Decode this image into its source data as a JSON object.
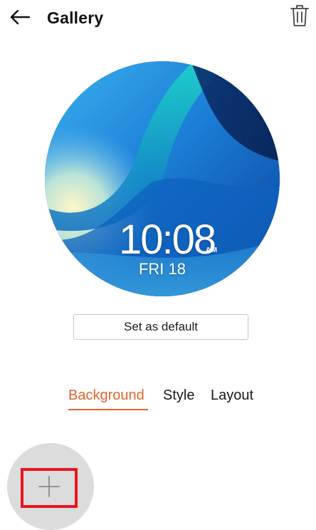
{
  "header": {
    "title": "Gallery",
    "back_icon": "arrow-left-icon",
    "delete_icon": "trash-icon"
  },
  "watch_face": {
    "time": "10:08",
    "ampm": "AM",
    "date": "FRI 18"
  },
  "actions": {
    "set_default_label": "Set as default"
  },
  "tabs": [
    {
      "label": "Background",
      "active": true
    },
    {
      "label": "Style",
      "active": false
    },
    {
      "label": "Layout",
      "active": false
    }
  ],
  "add_background": {
    "icon": "plus-icon"
  },
  "colors": {
    "accent": "#e0652c",
    "highlight_border": "#e8161b",
    "add_circle_bg": "#dcdcdc"
  }
}
